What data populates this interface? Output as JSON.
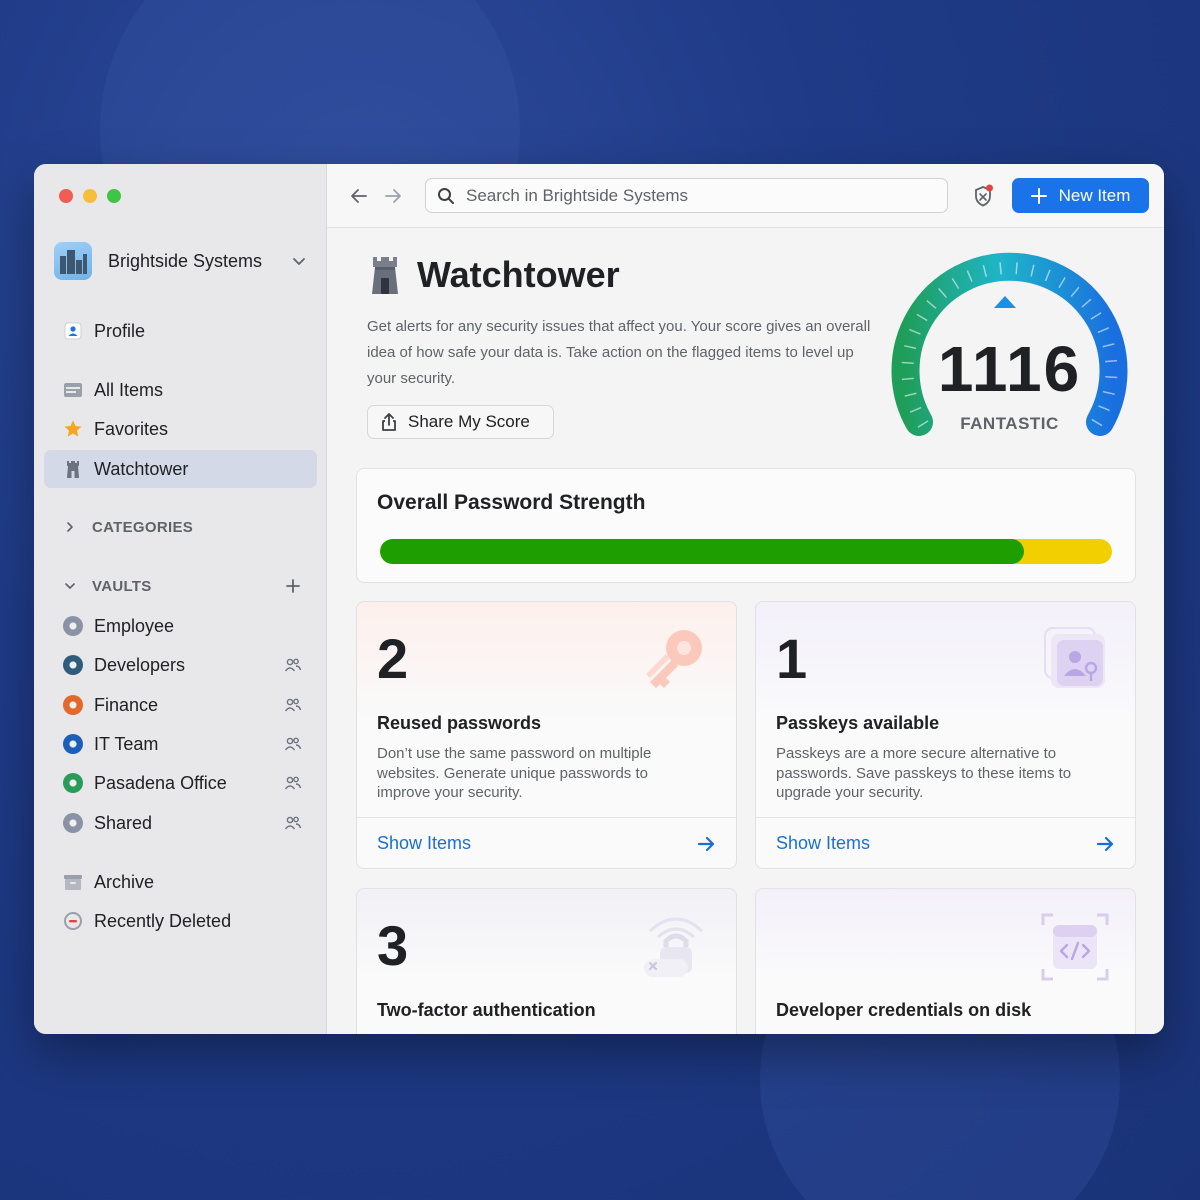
{
  "window": {
    "account_name": "Brightside Systems"
  },
  "sidebar": {
    "profile": "Profile",
    "all_items": "All Items",
    "favorites": "Favorites",
    "watchtower": "Watchtower",
    "categories_title": "CATEGORIES",
    "vaults_title": "VAULTS",
    "vaults": [
      {
        "label": "Employee",
        "color": "#8a93a5",
        "shared": false
      },
      {
        "label": "Developers",
        "color": "#2f5c7a",
        "shared": true
      },
      {
        "label": "Finance",
        "color": "#e2682b",
        "shared": true
      },
      {
        "label": "IT Team",
        "color": "#1c5fb8",
        "shared": true
      },
      {
        "label": "Pasadena Office",
        "color": "#2a9b5a",
        "shared": true
      },
      {
        "label": "Shared",
        "color": "#8a93a5",
        "shared": true
      }
    ],
    "archive": "Archive",
    "recently_deleted": "Recently Deleted"
  },
  "toolbar": {
    "search_placeholder": "Search in Brightside Systems",
    "new_item": "New Item"
  },
  "header": {
    "title": "Watchtower",
    "description": "Get alerts for any security issues that affect you. Your score gives an overall idea of how safe your data is. Take action on the flagged items to level up your security.",
    "share_button": "Share My Score"
  },
  "gauge": {
    "score": "1116",
    "rating": "FANTASTIC"
  },
  "strength": {
    "title": "Overall Password Strength",
    "fill_fraction": 0.88,
    "fill_color": "#1f9e00",
    "rest_color": "#f2cf00"
  },
  "cards": [
    {
      "number": "2",
      "title": "Reused passwords",
      "description": "Don’t use the same password on multiple websites. Generate unique passwords to improve your security.",
      "action": "Show Items"
    },
    {
      "number": "1",
      "title": "Passkeys available",
      "description": "Passkeys are a more secure alternative to passwords. Save passkeys to these items to upgrade your security.",
      "action": "Show Items"
    },
    {
      "number": "3",
      "title": "Two-factor authentication"
    },
    {
      "number": "",
      "title": "Developer credentials on disk"
    }
  ],
  "colors": {
    "accent": "#1a73e8",
    "link": "#1a6fd6"
  }
}
